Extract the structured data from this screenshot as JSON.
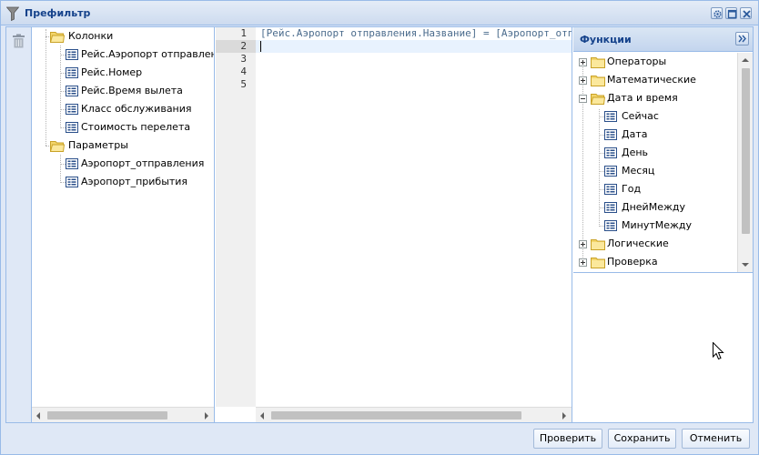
{
  "window": {
    "title": "Префильтр"
  },
  "fields": {
    "groups": [
      {
        "label": "Колонки",
        "items": [
          "Рейс.Аэропорт отправления.Название",
          "Рейс.Номер",
          "Рейс.Время вылета",
          "Класс обслуживания",
          "Стоимость перелета"
        ]
      },
      {
        "label": "Параметры",
        "items": [
          "Аэропорт_отправления",
          "Аэропорт_прибытия"
        ]
      }
    ]
  },
  "editor": {
    "line_numbers": [
      "1",
      "2",
      "3",
      "4",
      "5"
    ],
    "lines": [
      "[Рейс.Аэропорт отправления.Название] = [Аэропорт_отправления]",
      "",
      "",
      "",
      ""
    ],
    "active_line": 2
  },
  "functions": {
    "title": "Функции",
    "groups": [
      {
        "label": "Операторы",
        "expanded": false
      },
      {
        "label": "Математические",
        "expanded": false
      },
      {
        "label": "Дата и время",
        "expanded": true,
        "items": [
          "Сейчас",
          "Дата",
          "День",
          "Месяц",
          "Год",
          "ДнейМежду",
          "МинутМежду"
        ]
      },
      {
        "label": "Логические",
        "expanded": false
      },
      {
        "label": "Проверка",
        "expanded": false
      }
    ]
  },
  "buttons": {
    "check": "Проверить",
    "save": "Сохранить",
    "cancel": "Отменить"
  },
  "colors": {
    "accent": "#15428b",
    "border": "#99bbe8",
    "folder": "#f3d56b"
  }
}
